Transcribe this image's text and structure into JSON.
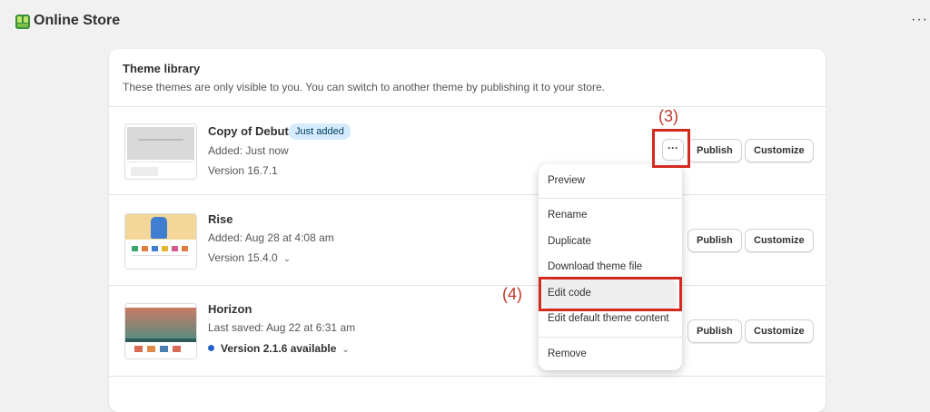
{
  "header": {
    "title": "Online Store",
    "more": "···"
  },
  "library": {
    "title": "Theme library",
    "description": "These themes are only visible to you. You can switch to another theme by publishing it to your store."
  },
  "themes": [
    {
      "name": "Copy of Debut",
      "badge": "Just added",
      "added": "Added: Just now",
      "version": "Version 16.7.1"
    },
    {
      "name": "Rise",
      "added": "Added: Aug 28 at 4:08 am",
      "version": "Version 15.4.0"
    },
    {
      "name": "Horizon",
      "added": "Last saved: Aug 22 at 6:31 am",
      "version": "Version 2.1.6 available"
    }
  ],
  "buttons": {
    "publish": "Publish",
    "customize": "Customize",
    "more": "···"
  },
  "menu": {
    "items": [
      "Preview",
      "Rename",
      "Duplicate",
      "Download theme file",
      "Edit code",
      "Edit default theme content",
      "Remove"
    ]
  },
  "annotations": {
    "step3": "(3)",
    "step4": "(4)"
  },
  "colors": {
    "highlight": "#d42a1e",
    "annotation": "#c0362c",
    "badge_bg": "#d5ebff",
    "version_dot": "#2563c9"
  }
}
